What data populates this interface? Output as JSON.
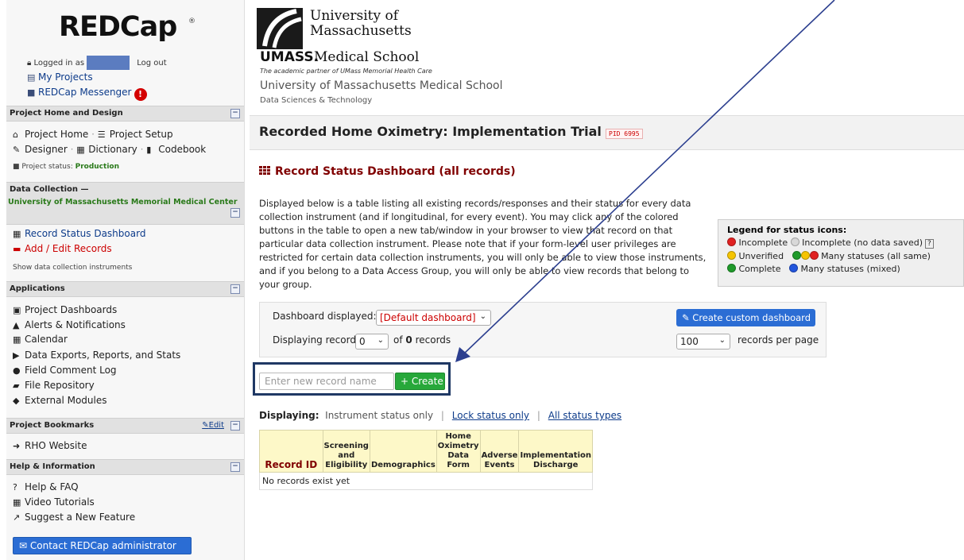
{
  "sidebar": {
    "logo": {
      "text": "REDCap",
      "reg": "®"
    },
    "user": {
      "logged_in_as": "Logged in as",
      "logout": "Log out"
    },
    "top_links": {
      "my_projects": "My Projects",
      "messenger": "REDCap Messenger",
      "messenger_badge": "!"
    },
    "project_home": {
      "header": "Project Home and Design",
      "project_home": "Project Home",
      "project_setup": "Project Setup",
      "designer": "Designer",
      "dictionary": "Dictionary",
      "codebook": "Codebook",
      "status_label": "Project status:",
      "status_value": "Production"
    },
    "data_collection": {
      "header": "Data Collection —",
      "org": "University of Massachusetts Memorial Medical Center",
      "record_status": "Record Status Dashboard",
      "add_edit": "Add / Edit Records",
      "show_instruments": "Show data collection instruments"
    },
    "applications": {
      "header": "Applications",
      "items": [
        "Project Dashboards",
        "Alerts & Notifications",
        "Calendar",
        "Data Exports, Reports, and Stats",
        "Field Comment Log",
        "File Repository",
        "External Modules"
      ]
    },
    "bookmarks": {
      "header": "Project Bookmarks",
      "edit": "Edit",
      "items": [
        "RHO Website"
      ]
    },
    "help": {
      "header": "Help & Information",
      "items": [
        "Help & FAQ",
        "Video Tutorials",
        "Suggest a New Feature"
      ],
      "contact": "Contact REDCap administrator"
    }
  },
  "institution": {
    "line1": "University of",
    "line2": "Massachusetts",
    "umass": "UMASS.",
    "line3": "Medical School",
    "tagline": "The academic partner of UMass Memorial Health Care",
    "school": "University of Massachusetts Medical School",
    "dept": "Data Sciences & Technology"
  },
  "project": {
    "title": "Recorded Home Oximetry: Implementation Trial",
    "pid": "PID 6995"
  },
  "page": {
    "heading": "Record Status Dashboard (all records)",
    "intro": "Displayed below is a table listing all existing records/responses and their status for every data collection instrument (and if longitudinal, for every event). You may click any of the colored buttons in the table to open a new tab/window in your browser to view that record on that particular data collection instrument. Please note that if your form-level user privileges are restricted for certain data collection instruments, you will only be able to view those instruments, and if you belong to a Data Access Group, you will only be able to view records that belong to your group."
  },
  "legend": {
    "title": "Legend for status icons:",
    "incomplete": "Incomplete",
    "incomplete_nodata": "Incomplete (no data saved)",
    "help": "?",
    "unverified": "Unverified",
    "many_same": "Many statuses (all same)",
    "complete": "Complete",
    "many_mixed": "Many statuses (mixed)"
  },
  "dashboard": {
    "displayed_label": "Dashboard displayed:",
    "displayed_value": "[Default dashboard]",
    "create_custom": "Create custom dashboard",
    "displaying_record_label": "Displaying record",
    "record_value": "0",
    "of_label": "of",
    "of_count": "0",
    "records_label": "records",
    "per_page_value": "100",
    "per_page_label": "records per page"
  },
  "new_record": {
    "placeholder": "Enter new record name",
    "create": "Create"
  },
  "display_toggle": {
    "label": "Displaying:",
    "instrument_only": "Instrument status only",
    "lock_only": "Lock status only",
    "all_types": "All status types"
  },
  "table": {
    "headers": [
      "Record ID",
      "Screening and Eligibility",
      "Demographics",
      "Home Oximetry Data Form",
      "Adverse Events",
      "Implementation Discharge"
    ],
    "empty": "No records exist yet"
  },
  "colors": {
    "accent_blue": "#2b6dd4",
    "create_green": "#27a83a",
    "heading_maroon": "#800000",
    "highlight_box": "#1f3864"
  }
}
